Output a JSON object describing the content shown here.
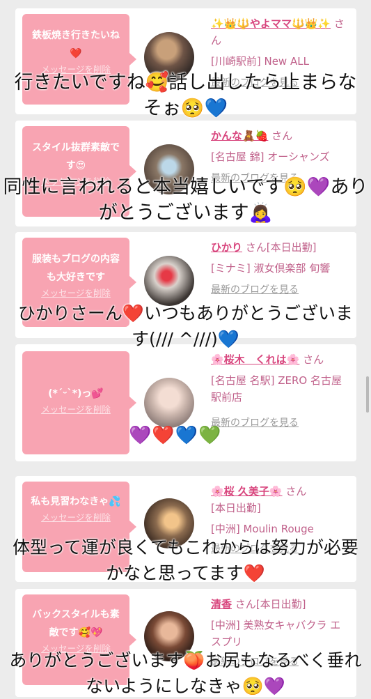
{
  "common": {
    "delete_label": "メッセージを削除",
    "blog_label": "最新のブログを見る",
    "san": "さん"
  },
  "messages": [
    {
      "bubble": "鉄板焼き行きたいね❤️",
      "cast_name": "✨👑🔱やよママ🔱👑✨",
      "suffix": "さん",
      "shop": "[川崎駅前] New ALL",
      "reply": "行きたいですね🥰話し出したら止まらなそぉ🥺💙"
    },
    {
      "bubble": "スタイル抜群素敵です😍",
      "cast_name": "かんな🧸🍓",
      "suffix": "さん",
      "shop": "[名古屋 錦] オーシャンズ",
      "reply": "同性に言われると本当嬉しいです🥺💜ありがとうございます🙇‍♀️"
    },
    {
      "bubble": "服装もブログの内容も大好きです",
      "cast_name": "ひかり",
      "suffix": "さん[本日出勤]",
      "shop": "[ミナミ] 淑女倶楽部 旬響",
      "reply": "ひかりさーん❤️いつもありがとうございます(/// ^///)💙"
    },
    {
      "bubble": "(*´ᵕ`*)っ💕",
      "cast_name": "🌸桜木　くれは🌸",
      "suffix": "さん",
      "shop": "[名古屋 名駅] ZERO 名古屋駅前店",
      "hearts": "💜❤️💙💚"
    },
    {
      "bubble": "私も見習わなきゃ💦",
      "cast_name": "🌸桜 久美子🌸",
      "suffix": "さん",
      "status": "[本日出勤]",
      "shop": "[中洲] Moulin Rouge",
      "reply": "体型って運が良くてもこれからは努力が必要かなと思ってます❤️"
    },
    {
      "bubble": "バックスタイルも素敵です🥰💖",
      "cast_name": "清香",
      "suffix": "さん[本日出勤]",
      "shop": "[中洲] 美熟女キャバクラ エスプリ",
      "reply": "ありがとうございます🍑お尻もなるべく垂れないようにしなきゃ🥺💜"
    }
  ],
  "colors": {
    "background": "#ececec",
    "bubble": "#f8a4b2",
    "name": "#d8467e",
    "shop": "#c0608a"
  }
}
